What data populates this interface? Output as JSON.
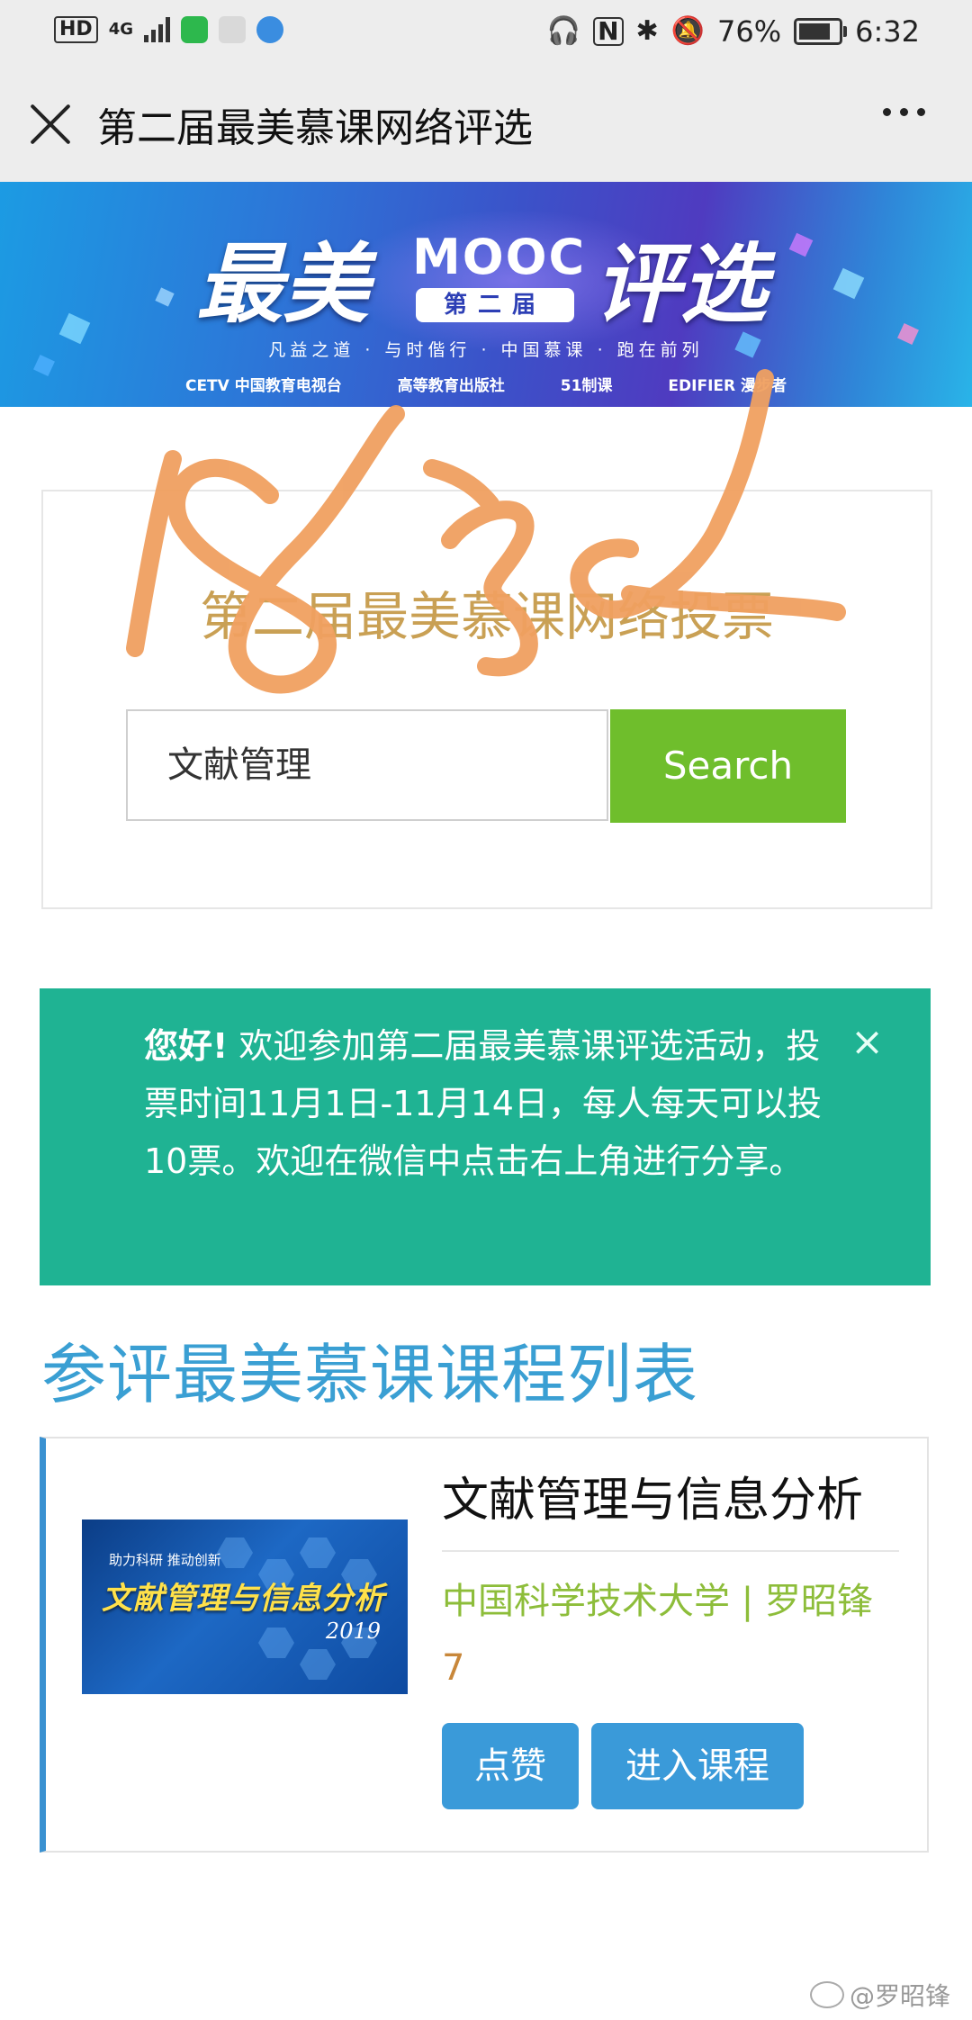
{
  "status_bar": {
    "hd": "HD",
    "network": "4G",
    "battery_pct": "76%",
    "time": "6:32",
    "icons": [
      "headphones-icon",
      "nfc-icon",
      "bluetooth-icon",
      "mute-icon",
      "battery-icon"
    ]
  },
  "title_bar": {
    "title": "第二届最美慕课网络评选"
  },
  "banner": {
    "title_left": "最美",
    "title_mooc": "MOOC",
    "title_right": "评选",
    "edition": "第二届",
    "slogan": "凡益之道 · 与时偕行 · 中国慕课 · 跑在前列",
    "sponsors": [
      "CETV 中国教育电视台",
      "高等教育出版社",
      "51制课",
      "EDIFIER 漫步者"
    ]
  },
  "vote_card": {
    "title": "第二届最美慕课网络投票",
    "search_value": "文献管理",
    "search_button": "Search"
  },
  "alert": {
    "greeting": "您好!",
    "message": " 欢迎参加第二届最美慕课评选活动，投票时间11月1日-11月14日，每人每天可以投10票。欢迎在微信中点击右上角进行分享。",
    "close": "×"
  },
  "list_heading": "参评最美慕课课程列表",
  "courses": [
    {
      "thumb_tag": "助力科研  推动创新",
      "thumb_title": "文献管理与信息分析",
      "thumb_year": "2019",
      "title": "文献管理与信息分析",
      "school": "中国科学技术大学 | 罗昭锋",
      "votes": "7",
      "like_button": "点赞",
      "enter_button": "进入课程"
    }
  ],
  "watermark": "@罗昭锋",
  "colors": {
    "accent_green": "#6fbe2c",
    "alert_teal": "#1fb393",
    "heading_blue": "#3a9fd3",
    "button_blue": "#3a9ad9",
    "handwriting_orange": "#f0a060"
  }
}
